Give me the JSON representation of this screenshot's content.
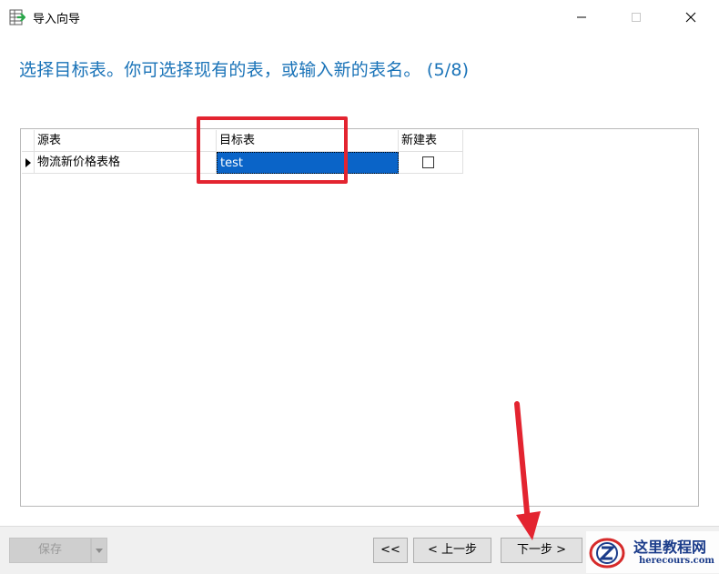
{
  "window": {
    "title": "导入向导",
    "icon": "table-import-icon",
    "controls": [
      "minimize-icon",
      "maximize-icon",
      "close-icon"
    ]
  },
  "header": {
    "instruction": "选择目标表。你可选择现有的表，或输入新的表名。 (5/8)"
  },
  "grid": {
    "columns": [
      "源表",
      "目标表",
      "新建表"
    ],
    "rows": [
      {
        "source": "物流新价格表格",
        "target": "test",
        "new_table": false
      }
    ]
  },
  "footer": {
    "save_label": "保存",
    "first_label": "<<",
    "prev_label": "< 上一步",
    "next_label": "下一步 >"
  },
  "watermark": {
    "cn": "这里教程网",
    "en": "herecours.com"
  },
  "colors": {
    "instruction": "#1a73b8",
    "selection": "#0a64c8",
    "annotation": "#e32430",
    "footer_bg": "#f0f0f0"
  }
}
